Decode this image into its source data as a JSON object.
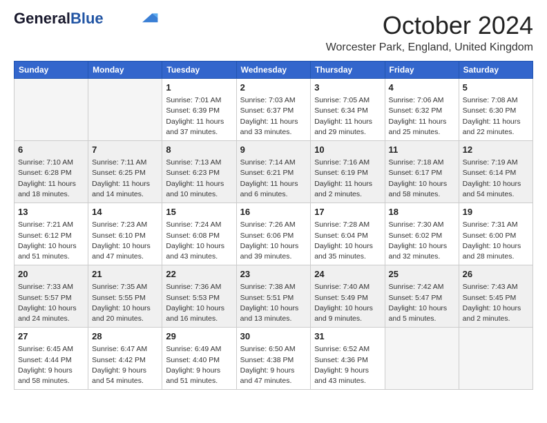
{
  "header": {
    "logo_general": "General",
    "logo_blue": "Blue",
    "month_title": "October 2024",
    "location": "Worcester Park, England, United Kingdom"
  },
  "days_of_week": [
    "Sunday",
    "Monday",
    "Tuesday",
    "Wednesday",
    "Thursday",
    "Friday",
    "Saturday"
  ],
  "weeks": [
    [
      {
        "day": "",
        "empty": true
      },
      {
        "day": "",
        "empty": true
      },
      {
        "day": "1",
        "sunrise": "Sunrise: 7:01 AM",
        "sunset": "Sunset: 6:39 PM",
        "daylight": "Daylight: 11 hours and 37 minutes."
      },
      {
        "day": "2",
        "sunrise": "Sunrise: 7:03 AM",
        "sunset": "Sunset: 6:37 PM",
        "daylight": "Daylight: 11 hours and 33 minutes."
      },
      {
        "day": "3",
        "sunrise": "Sunrise: 7:05 AM",
        "sunset": "Sunset: 6:34 PM",
        "daylight": "Daylight: 11 hours and 29 minutes."
      },
      {
        "day": "4",
        "sunrise": "Sunrise: 7:06 AM",
        "sunset": "Sunset: 6:32 PM",
        "daylight": "Daylight: 11 hours and 25 minutes."
      },
      {
        "day": "5",
        "sunrise": "Sunrise: 7:08 AM",
        "sunset": "Sunset: 6:30 PM",
        "daylight": "Daylight: 11 hours and 22 minutes."
      }
    ],
    [
      {
        "day": "6",
        "sunrise": "Sunrise: 7:10 AM",
        "sunset": "Sunset: 6:28 PM",
        "daylight": "Daylight: 11 hours and 18 minutes."
      },
      {
        "day": "7",
        "sunrise": "Sunrise: 7:11 AM",
        "sunset": "Sunset: 6:25 PM",
        "daylight": "Daylight: 11 hours and 14 minutes."
      },
      {
        "day": "8",
        "sunrise": "Sunrise: 7:13 AM",
        "sunset": "Sunset: 6:23 PM",
        "daylight": "Daylight: 11 hours and 10 minutes."
      },
      {
        "day": "9",
        "sunrise": "Sunrise: 7:14 AM",
        "sunset": "Sunset: 6:21 PM",
        "daylight": "Daylight: 11 hours and 6 minutes."
      },
      {
        "day": "10",
        "sunrise": "Sunrise: 7:16 AM",
        "sunset": "Sunset: 6:19 PM",
        "daylight": "Daylight: 11 hours and 2 minutes."
      },
      {
        "day": "11",
        "sunrise": "Sunrise: 7:18 AM",
        "sunset": "Sunset: 6:17 PM",
        "daylight": "Daylight: 10 hours and 58 minutes."
      },
      {
        "day": "12",
        "sunrise": "Sunrise: 7:19 AM",
        "sunset": "Sunset: 6:14 PM",
        "daylight": "Daylight: 10 hours and 54 minutes."
      }
    ],
    [
      {
        "day": "13",
        "sunrise": "Sunrise: 7:21 AM",
        "sunset": "Sunset: 6:12 PM",
        "daylight": "Daylight: 10 hours and 51 minutes."
      },
      {
        "day": "14",
        "sunrise": "Sunrise: 7:23 AM",
        "sunset": "Sunset: 6:10 PM",
        "daylight": "Daylight: 10 hours and 47 minutes."
      },
      {
        "day": "15",
        "sunrise": "Sunrise: 7:24 AM",
        "sunset": "Sunset: 6:08 PM",
        "daylight": "Daylight: 10 hours and 43 minutes."
      },
      {
        "day": "16",
        "sunrise": "Sunrise: 7:26 AM",
        "sunset": "Sunset: 6:06 PM",
        "daylight": "Daylight: 10 hours and 39 minutes."
      },
      {
        "day": "17",
        "sunrise": "Sunrise: 7:28 AM",
        "sunset": "Sunset: 6:04 PM",
        "daylight": "Daylight: 10 hours and 35 minutes."
      },
      {
        "day": "18",
        "sunrise": "Sunrise: 7:30 AM",
        "sunset": "Sunset: 6:02 PM",
        "daylight": "Daylight: 10 hours and 32 minutes."
      },
      {
        "day": "19",
        "sunrise": "Sunrise: 7:31 AM",
        "sunset": "Sunset: 6:00 PM",
        "daylight": "Daylight: 10 hours and 28 minutes."
      }
    ],
    [
      {
        "day": "20",
        "sunrise": "Sunrise: 7:33 AM",
        "sunset": "Sunset: 5:57 PM",
        "daylight": "Daylight: 10 hours and 24 minutes."
      },
      {
        "day": "21",
        "sunrise": "Sunrise: 7:35 AM",
        "sunset": "Sunset: 5:55 PM",
        "daylight": "Daylight: 10 hours and 20 minutes."
      },
      {
        "day": "22",
        "sunrise": "Sunrise: 7:36 AM",
        "sunset": "Sunset: 5:53 PM",
        "daylight": "Daylight: 10 hours and 16 minutes."
      },
      {
        "day": "23",
        "sunrise": "Sunrise: 7:38 AM",
        "sunset": "Sunset: 5:51 PM",
        "daylight": "Daylight: 10 hours and 13 minutes."
      },
      {
        "day": "24",
        "sunrise": "Sunrise: 7:40 AM",
        "sunset": "Sunset: 5:49 PM",
        "daylight": "Daylight: 10 hours and 9 minutes."
      },
      {
        "day": "25",
        "sunrise": "Sunrise: 7:42 AM",
        "sunset": "Sunset: 5:47 PM",
        "daylight": "Daylight: 10 hours and 5 minutes."
      },
      {
        "day": "26",
        "sunrise": "Sunrise: 7:43 AM",
        "sunset": "Sunset: 5:45 PM",
        "daylight": "Daylight: 10 hours and 2 minutes."
      }
    ],
    [
      {
        "day": "27",
        "sunrise": "Sunrise: 6:45 AM",
        "sunset": "Sunset: 4:44 PM",
        "daylight": "Daylight: 9 hours and 58 minutes."
      },
      {
        "day": "28",
        "sunrise": "Sunrise: 6:47 AM",
        "sunset": "Sunset: 4:42 PM",
        "daylight": "Daylight: 9 hours and 54 minutes."
      },
      {
        "day": "29",
        "sunrise": "Sunrise: 6:49 AM",
        "sunset": "Sunset: 4:40 PM",
        "daylight": "Daylight: 9 hours and 51 minutes."
      },
      {
        "day": "30",
        "sunrise": "Sunrise: 6:50 AM",
        "sunset": "Sunset: 4:38 PM",
        "daylight": "Daylight: 9 hours and 47 minutes."
      },
      {
        "day": "31",
        "sunrise": "Sunrise: 6:52 AM",
        "sunset": "Sunset: 4:36 PM",
        "daylight": "Daylight: 9 hours and 43 minutes."
      },
      {
        "day": "",
        "empty": true
      },
      {
        "day": "",
        "empty": true
      }
    ]
  ]
}
